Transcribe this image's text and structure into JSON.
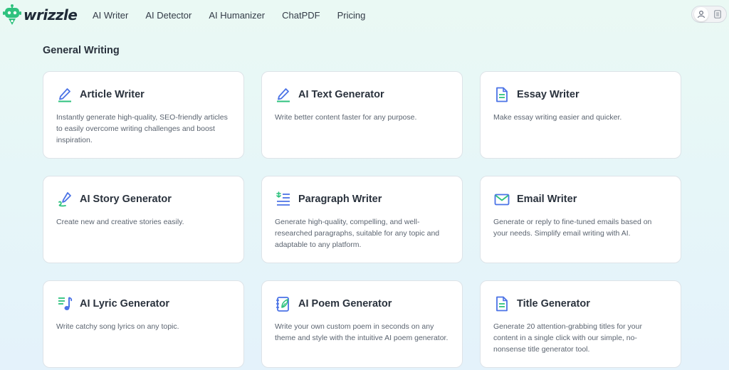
{
  "brand": {
    "name": "wrizzle",
    "colors": {
      "accent": "#4b73e6",
      "green": "#2ec27e",
      "text": "#2a323d"
    }
  },
  "nav": {
    "items": [
      "AI Writer",
      "AI Detector",
      "AI Humanizer",
      "ChatPDF",
      "Pricing"
    ]
  },
  "user_menu": {
    "icons": [
      "user-icon",
      "menu-list-icon"
    ]
  },
  "section": {
    "title": "General Writing"
  },
  "cards": [
    {
      "title": "Article Writer",
      "icon": "pencil-icon",
      "desc": "Instantly generate high-quality, SEO-friendly articles to easily overcome writing challenges and boost inspiration."
    },
    {
      "title": "AI Text Generator",
      "icon": "pencil-icon",
      "desc": "Write better content faster for any purpose."
    },
    {
      "title": "Essay Writer",
      "icon": "document-icon",
      "desc": "Make essay writing easier and quicker."
    },
    {
      "title": "AI Story Generator",
      "icon": "quill-scribble-icon",
      "desc": "Create new and creative stories easily."
    },
    {
      "title": "Paragraph Writer",
      "icon": "paragraph-lines-icon",
      "desc": "Generate high-quality, compelling, and well-researched paragraphs, suitable for any topic and adaptable to any platform."
    },
    {
      "title": "Email Writer",
      "icon": "envelope-icon",
      "desc": "Generate or reply to fine-tuned emails based on your needs. Simplify email writing with AI."
    },
    {
      "title": "AI Lyric Generator",
      "icon": "music-note-list-icon",
      "desc": "Write catchy song lyrics on any topic."
    },
    {
      "title": "AI Poem Generator",
      "icon": "notebook-leaf-icon",
      "desc": "Write your own custom poem in seconds on any theme and style with the intuitive AI poem generator."
    },
    {
      "title": "Title Generator",
      "icon": "document-icon",
      "desc": "Generate 20 attention-grabbing titles for your content in a single click with our simple, no-nonsense title generator tool."
    }
  ]
}
